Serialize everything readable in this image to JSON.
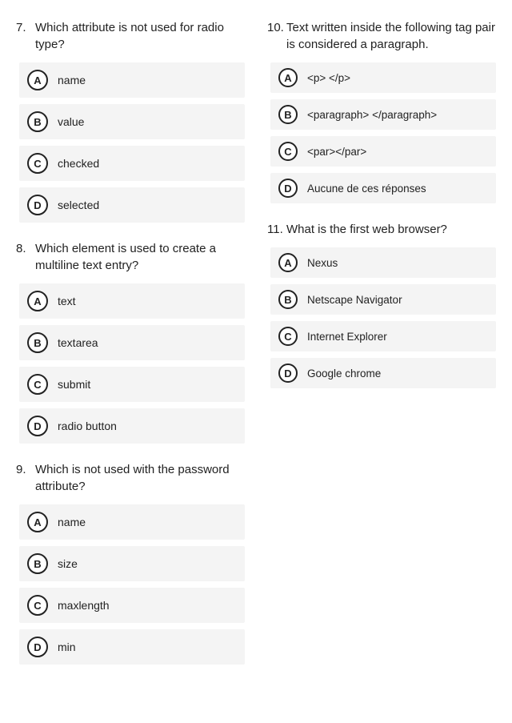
{
  "left": [
    {
      "num": "7.",
      "text": "Which attribute is not used for radio type?",
      "options": [
        {
          "letter": "A",
          "label": "name"
        },
        {
          "letter": "B",
          "label": "value"
        },
        {
          "letter": "C",
          "label": "checked"
        },
        {
          "letter": "D",
          "label": "selected"
        }
      ]
    },
    {
      "num": "8.",
      "text": "Which element is used to create a multiline text entry?",
      "options": [
        {
          "letter": "A",
          "label": "text"
        },
        {
          "letter": "B",
          "label": "textarea"
        },
        {
          "letter": "C",
          "label": "submit"
        },
        {
          "letter": "D",
          "label": "radio button"
        }
      ]
    },
    {
      "num": "9.",
      "text": "Which is not used with the password attribute?",
      "options": [
        {
          "letter": "A",
          "label": "name"
        },
        {
          "letter": "B",
          "label": "size"
        },
        {
          "letter": "C",
          "label": "maxlength"
        },
        {
          "letter": "D",
          "label": "min"
        }
      ]
    }
  ],
  "right": [
    {
      "num": "10.",
      "text": "Text written inside the following tag pair is considered a paragraph.",
      "options": [
        {
          "letter": "A",
          "label": "<p> </p>"
        },
        {
          "letter": "B",
          "label": "<paragraph> </paragraph>"
        },
        {
          "letter": "C",
          "label": "<par></par>"
        },
        {
          "letter": "D",
          "label": "Aucune de ces réponses"
        }
      ]
    },
    {
      "num": "11.",
      "text": "What is the first web browser?",
      "options": [
        {
          "letter": "A",
          "label": "Nexus"
        },
        {
          "letter": "B",
          "label": "Netscape Navigator"
        },
        {
          "letter": "C",
          "label": "Internet Explorer"
        },
        {
          "letter": "D",
          "label": "Google chrome"
        }
      ]
    }
  ]
}
